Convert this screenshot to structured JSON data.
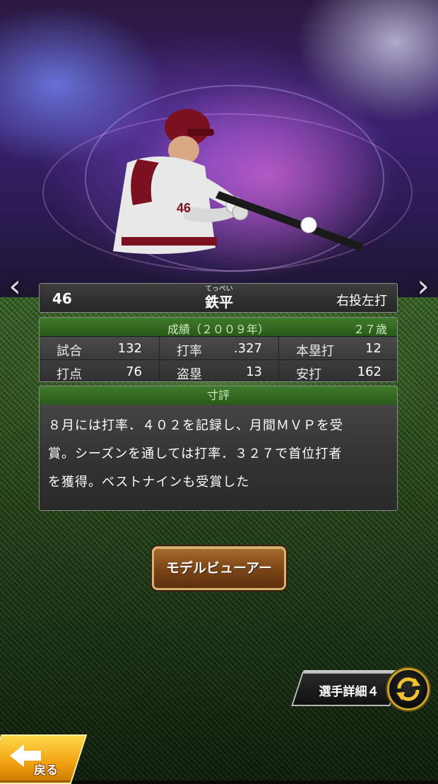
{
  "player": {
    "number": "46",
    "furigana": "てっぺい",
    "name": "鉄平",
    "throw_bat": "右投左打"
  },
  "stats": {
    "season_label": "成績（２００９年）",
    "age_label": "２７歳",
    "rows": [
      [
        {
          "label": "試合",
          "value": "132"
        },
        {
          "label": "打率",
          "value": ".327"
        },
        {
          "label": "本塁打",
          "value": "12"
        }
      ],
      [
        {
          "label": "打点",
          "value": "76"
        },
        {
          "label": "盗塁",
          "value": "13"
        },
        {
          "label": "安打",
          "value": "162"
        }
      ]
    ]
  },
  "comment": {
    "title": "寸評",
    "lines": [
      "８月には打率．４０２を記録し、月間ＭＶＰを受",
      "賞。シーズンを通しては打率．３２７で首位打者",
      "を獲得。ベストナインも受賞した"
    ]
  },
  "buttons": {
    "model_viewer": "モデルビューアー",
    "player_detail": "選手詳細４",
    "back": "戻る"
  },
  "icons": {
    "prev": "chevron-left-icon",
    "next": "chevron-right-icon",
    "switch": "swap-arrows-icon",
    "back": "back-arrow-icon"
  },
  "colors": {
    "header_green": "#3f7a2a",
    "button_brown": "#7a4416",
    "gold": "#c9a22a",
    "back_yellow": "#f0a010"
  }
}
